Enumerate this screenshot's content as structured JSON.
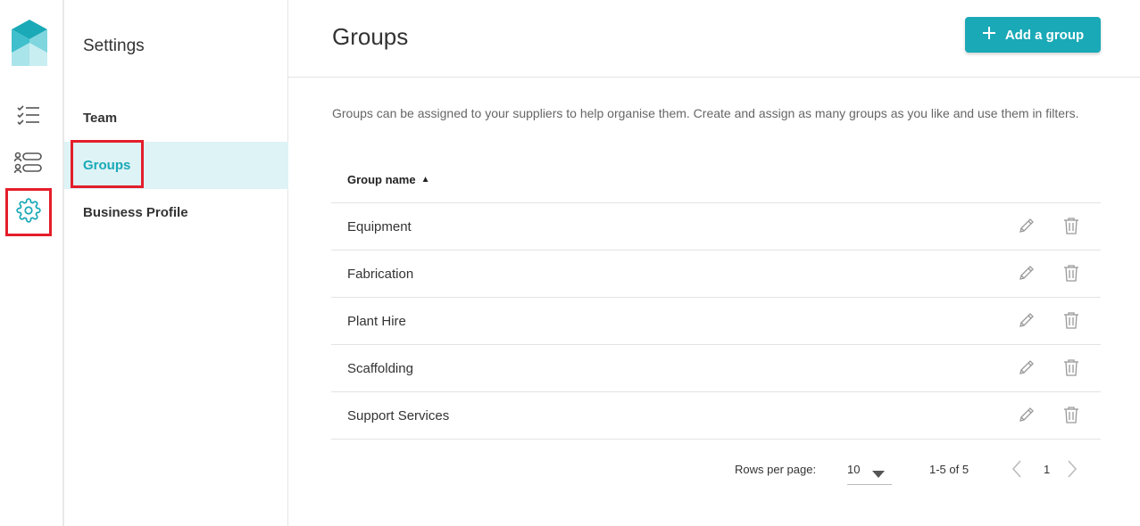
{
  "rail": {
    "items": [
      {
        "icon": "checklist-icon"
      },
      {
        "icon": "suppliers-icon"
      },
      {
        "icon": "gear-icon",
        "active": true
      }
    ]
  },
  "settings_nav": {
    "title": "Settings",
    "items": [
      {
        "label": "Team"
      },
      {
        "label": "Groups",
        "active": true
      },
      {
        "label": "Business Profile"
      }
    ]
  },
  "page": {
    "title": "Groups",
    "add_button_label": "Add a group",
    "description": "Groups can be assigned to your suppliers to help organise them. Create and assign as many groups as you like and use them in filters."
  },
  "table": {
    "column_header": "Group name",
    "rows": [
      {
        "name": "Equipment"
      },
      {
        "name": "Fabrication"
      },
      {
        "name": "Plant Hire"
      },
      {
        "name": "Scaffolding"
      },
      {
        "name": "Support Services"
      }
    ]
  },
  "pagination": {
    "rows_per_page_label": "Rows per page:",
    "rows_per_page_value": "10",
    "range_text": "1-5 of 5",
    "current_page": "1"
  },
  "colors": {
    "accent": "#1aa9b7",
    "active_bg": "#def3f5",
    "highlight": "#e41e2b"
  }
}
